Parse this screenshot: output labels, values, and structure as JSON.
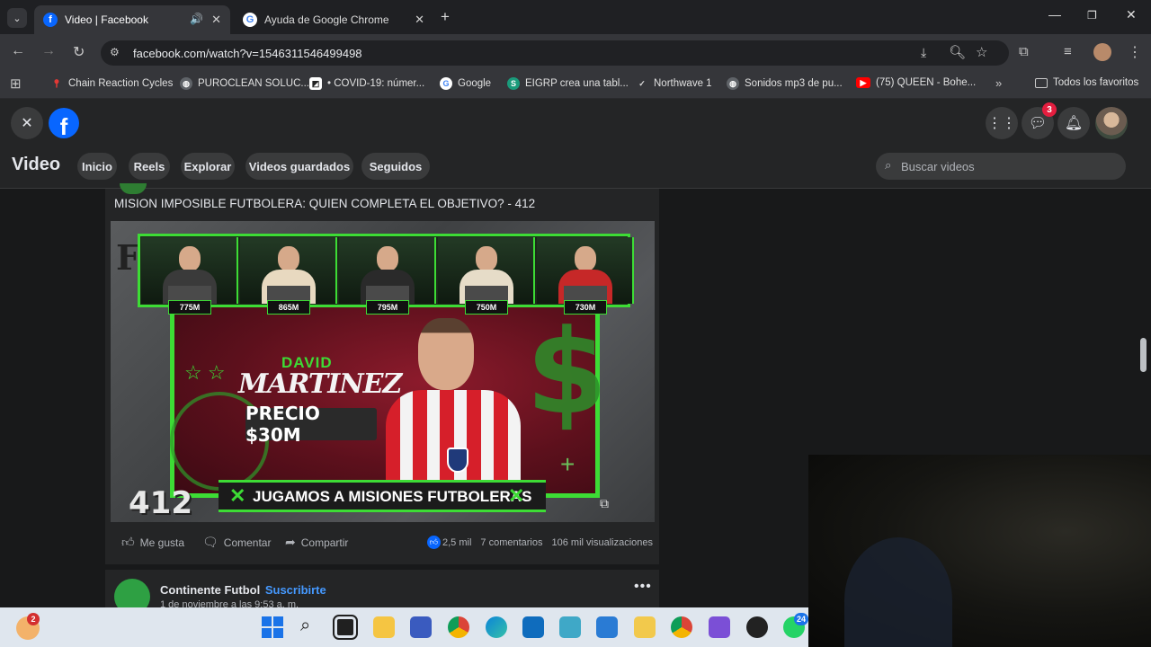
{
  "browser": {
    "tabs": [
      {
        "title": "Video | Facebook",
        "active": true
      },
      {
        "title": "Ayuda de Google Chrome",
        "active": false
      }
    ],
    "url": "facebook.com/watch?v=1546311546499498",
    "bookmarks": [
      "Chain Reaction Cycles",
      "PUROCLEAN SOLUC...",
      "• COVID-19: númer...",
      "Google",
      "EIGRP crea una tabl...",
      "Northwave 1",
      "Sonidos mp3 de pu...",
      "(75) QUEEN - Bohe...",
      "Todos los favoritos"
    ]
  },
  "facebook": {
    "page_title": "Video",
    "nav": [
      "Inicio",
      "Reels",
      "Explorar",
      "Videos guardados",
      "Seguidos"
    ],
    "search_placeholder": "Buscar videos",
    "messenger_badge": "3",
    "post": {
      "title": "MISION IMPOSIBLE FUTBOLERA: QUIEN COMPLETA EL OBJETIVO? - 412",
      "actions": {
        "like": "Me gusta",
        "comment": "Comentar",
        "share": "Compartir"
      },
      "stats": {
        "reactions": "2,5 mil",
        "comments": "7 comentarios",
        "views": "106 mil visualizaciones"
      }
    },
    "video": {
      "budgets": [
        "775M",
        "865M",
        "795M",
        "750M",
        "730M"
      ],
      "player_first": "DAVID",
      "player_last": "MARTINEZ",
      "price": "PRECIO $30M",
      "episode": "412",
      "banner": "JUGAMOS A MISIONES FUTBOLERAS"
    },
    "next_post": {
      "author": "Continente Futbol",
      "subscribe": "Suscribirte",
      "date": "1 de noviembre a las 9:53 a. m."
    }
  },
  "taskbar": {
    "notification_badge": "2",
    "whatsapp_badge": "24"
  },
  "colors": {
    "fb_blue": "#0866ff",
    "badge_red": "#e41e3f",
    "neon_green": "#3ddc35"
  }
}
